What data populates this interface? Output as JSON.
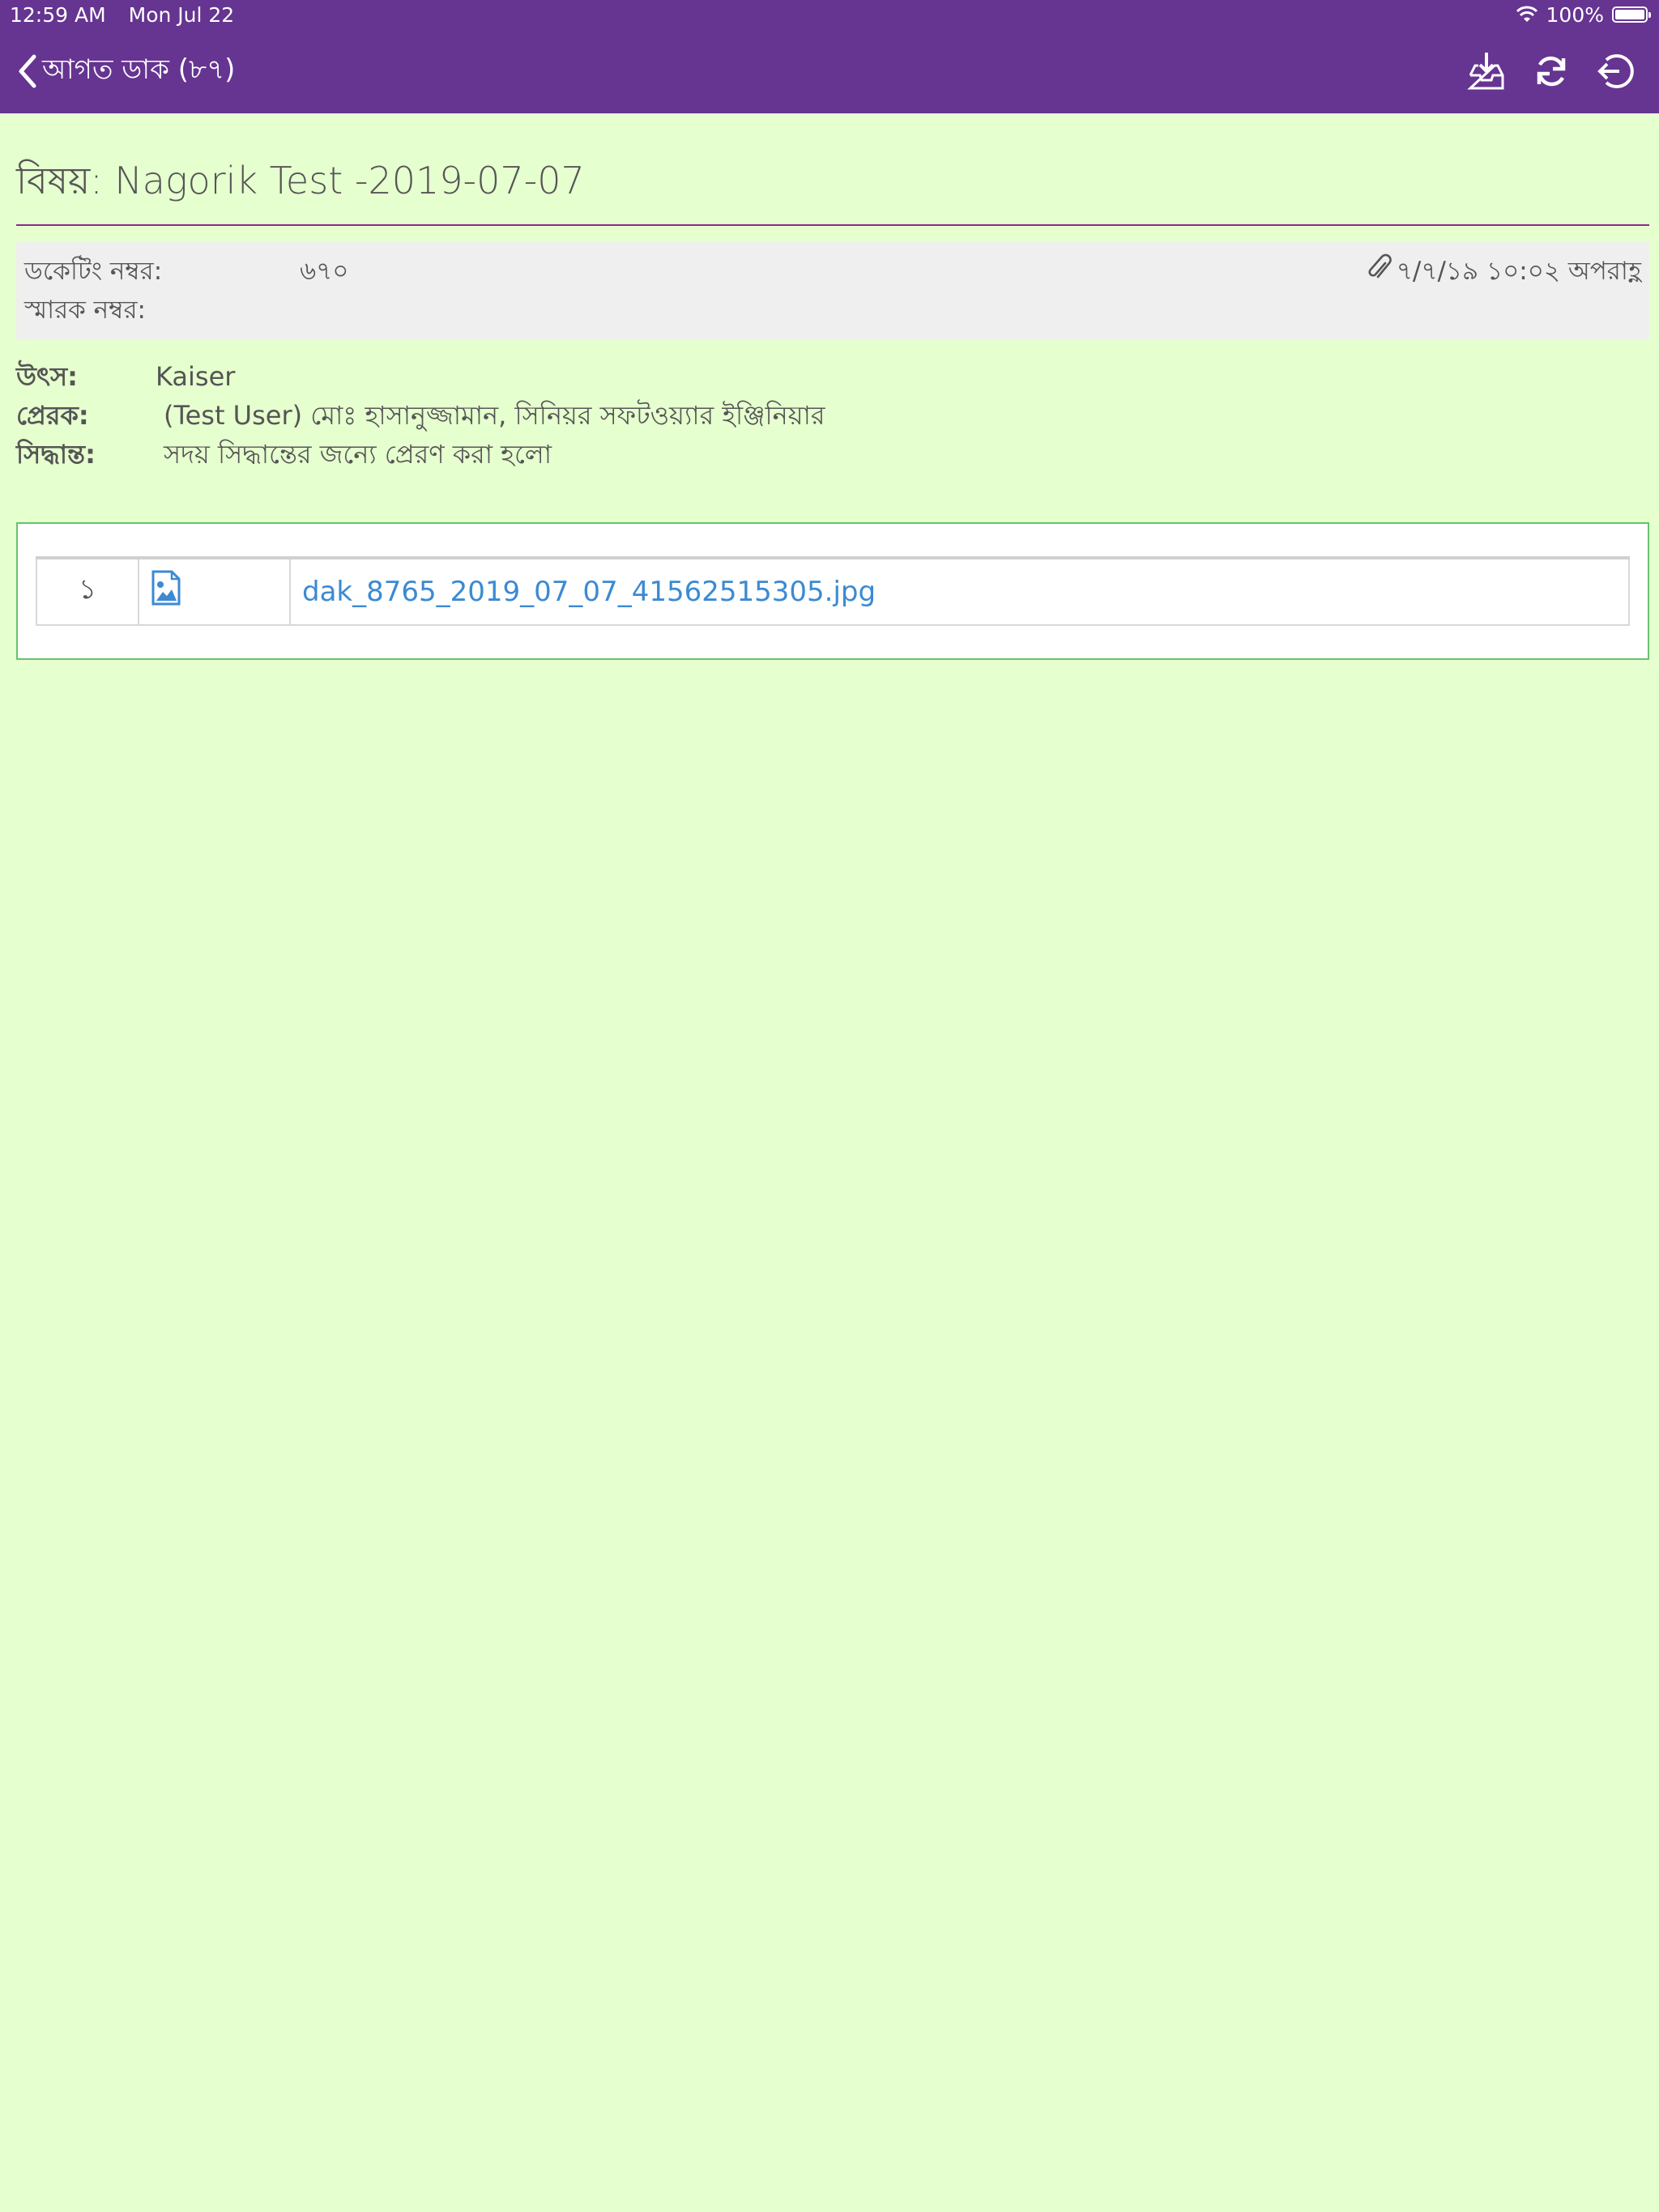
{
  "status_bar": {
    "time": "12:59 AM",
    "date": "Mon Jul 22",
    "battery": "100%"
  },
  "nav": {
    "back_label": "আগত ডাক (৮৭)",
    "actions": [
      "inbox-download-icon",
      "refresh-icon",
      "logout-icon"
    ]
  },
  "subject": "বিষয়: Nagorik Test -2019-07-07",
  "meta": {
    "docketing_label": "ডকেটিং নম্বর:",
    "docketing_value": "৬৭০",
    "memo_label": "স্মারক নম্বর:",
    "datetime": "৭/৭/১৯ ১০:০২ অপরাহ্ণ"
  },
  "info": {
    "source_label": "উৎস:",
    "source_value": "Kaiser",
    "sender_label": "প্রেরক:",
    "sender_value": "(Test User) মোঃ হাসানুজ্জামান, সিনিয়র সফটওয়্যার ইঞ্জিনিয়ার",
    "decision_label": "সিদ্ধান্ত:",
    "decision_value": "সদয় সিদ্ধান্তের জন্যে প্রেরণ করা হলো"
  },
  "attachments": [
    {
      "index": "১",
      "icon": "image-file-icon",
      "filename": "dak_8765_2019_07_07_41562515305.jpg"
    }
  ],
  "colors": {
    "header": "#663491",
    "background": "#e6ffcf",
    "link": "#3b8ad3",
    "rule": "#8a2b8b",
    "box_border": "#67c26d"
  }
}
